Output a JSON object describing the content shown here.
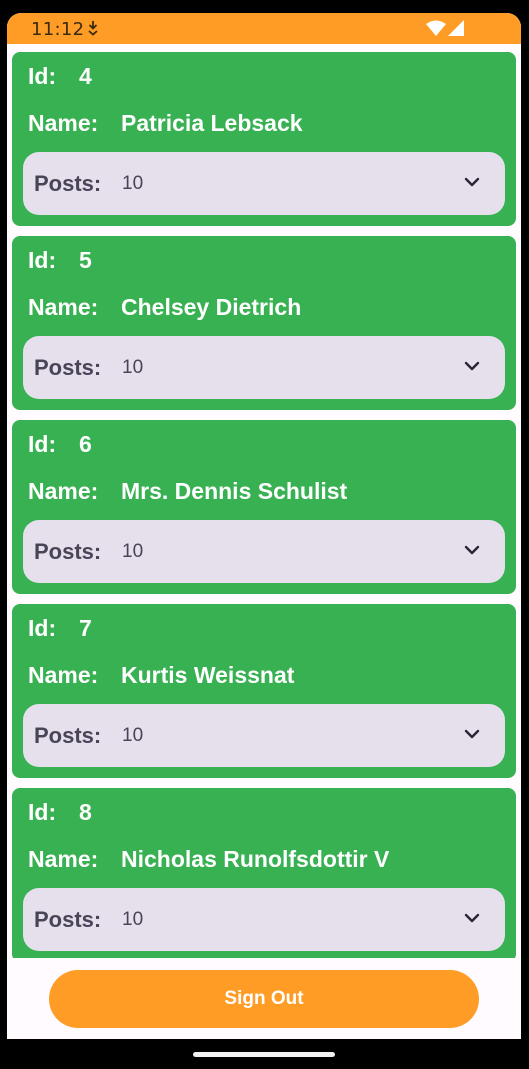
{
  "status_bar": {
    "time": "11:12",
    "icons": [
      "download-icon",
      "wifi-icon",
      "signal-icon"
    ]
  },
  "labels": {
    "id": "Id:",
    "name": "Name:",
    "posts": "Posts:"
  },
  "users": [
    {
      "id": "4",
      "name": "Patricia Lebsack",
      "posts": "10"
    },
    {
      "id": "5",
      "name": "Chelsey Dietrich",
      "posts": "10"
    },
    {
      "id": "6",
      "name": "Mrs. Dennis Schulist",
      "posts": "10"
    },
    {
      "id": "7",
      "name": "Kurtis Weissnat",
      "posts": "10"
    },
    {
      "id": "8",
      "name": "Nicholas Runolfsdottir V",
      "posts": "10"
    }
  ],
  "actions": {
    "sign_out": "Sign Out"
  },
  "colors": {
    "accent": "#ff9c25",
    "card": "#38b153",
    "select_bg": "#e6e0ec"
  }
}
